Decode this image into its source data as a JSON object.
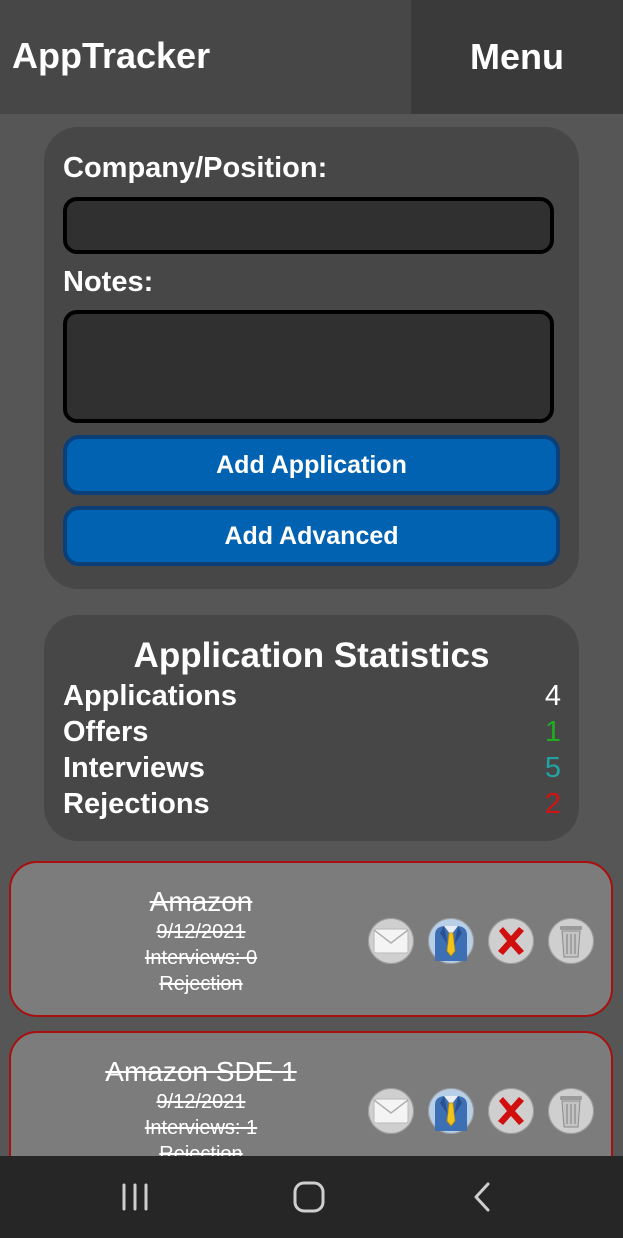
{
  "header": {
    "title": "AppTracker",
    "menu_label": "Menu"
  },
  "form": {
    "company_label": "Company/Position:",
    "company_value": "",
    "notes_label": "Notes:",
    "notes_value": "",
    "add_application_label": "Add Application",
    "add_advanced_label": "Add Advanced"
  },
  "stats": {
    "title": "Application Statistics",
    "rows": [
      {
        "label": "Applications",
        "value": "4",
        "color": "#ffffff"
      },
      {
        "label": "Offers",
        "value": "1",
        "color": "#1fae1f"
      },
      {
        "label": "Interviews",
        "value": "5",
        "color": "#21a3a3"
      },
      {
        "label": "Rejections",
        "value": "2",
        "color": "#d21414"
      }
    ]
  },
  "applications": [
    {
      "name": "Amazon",
      "date": "9/12/2021",
      "interviews": "Interviews: 0",
      "status": "Rejection"
    },
    {
      "name": "Amazon SDE 1",
      "date": "9/12/2021",
      "interviews": "Interviews: 1",
      "status": "Rejection"
    }
  ],
  "icons": {
    "email": "envelope-icon",
    "interview": "suit-tie-icon",
    "reject": "red-x-icon",
    "delete": "trash-can-icon"
  },
  "navbar": {
    "recents": "recents-icon",
    "home": "home-icon",
    "back": "back-icon"
  },
  "colors": {
    "accent_button": "#0062b0",
    "card_border": "#a80f0f"
  }
}
